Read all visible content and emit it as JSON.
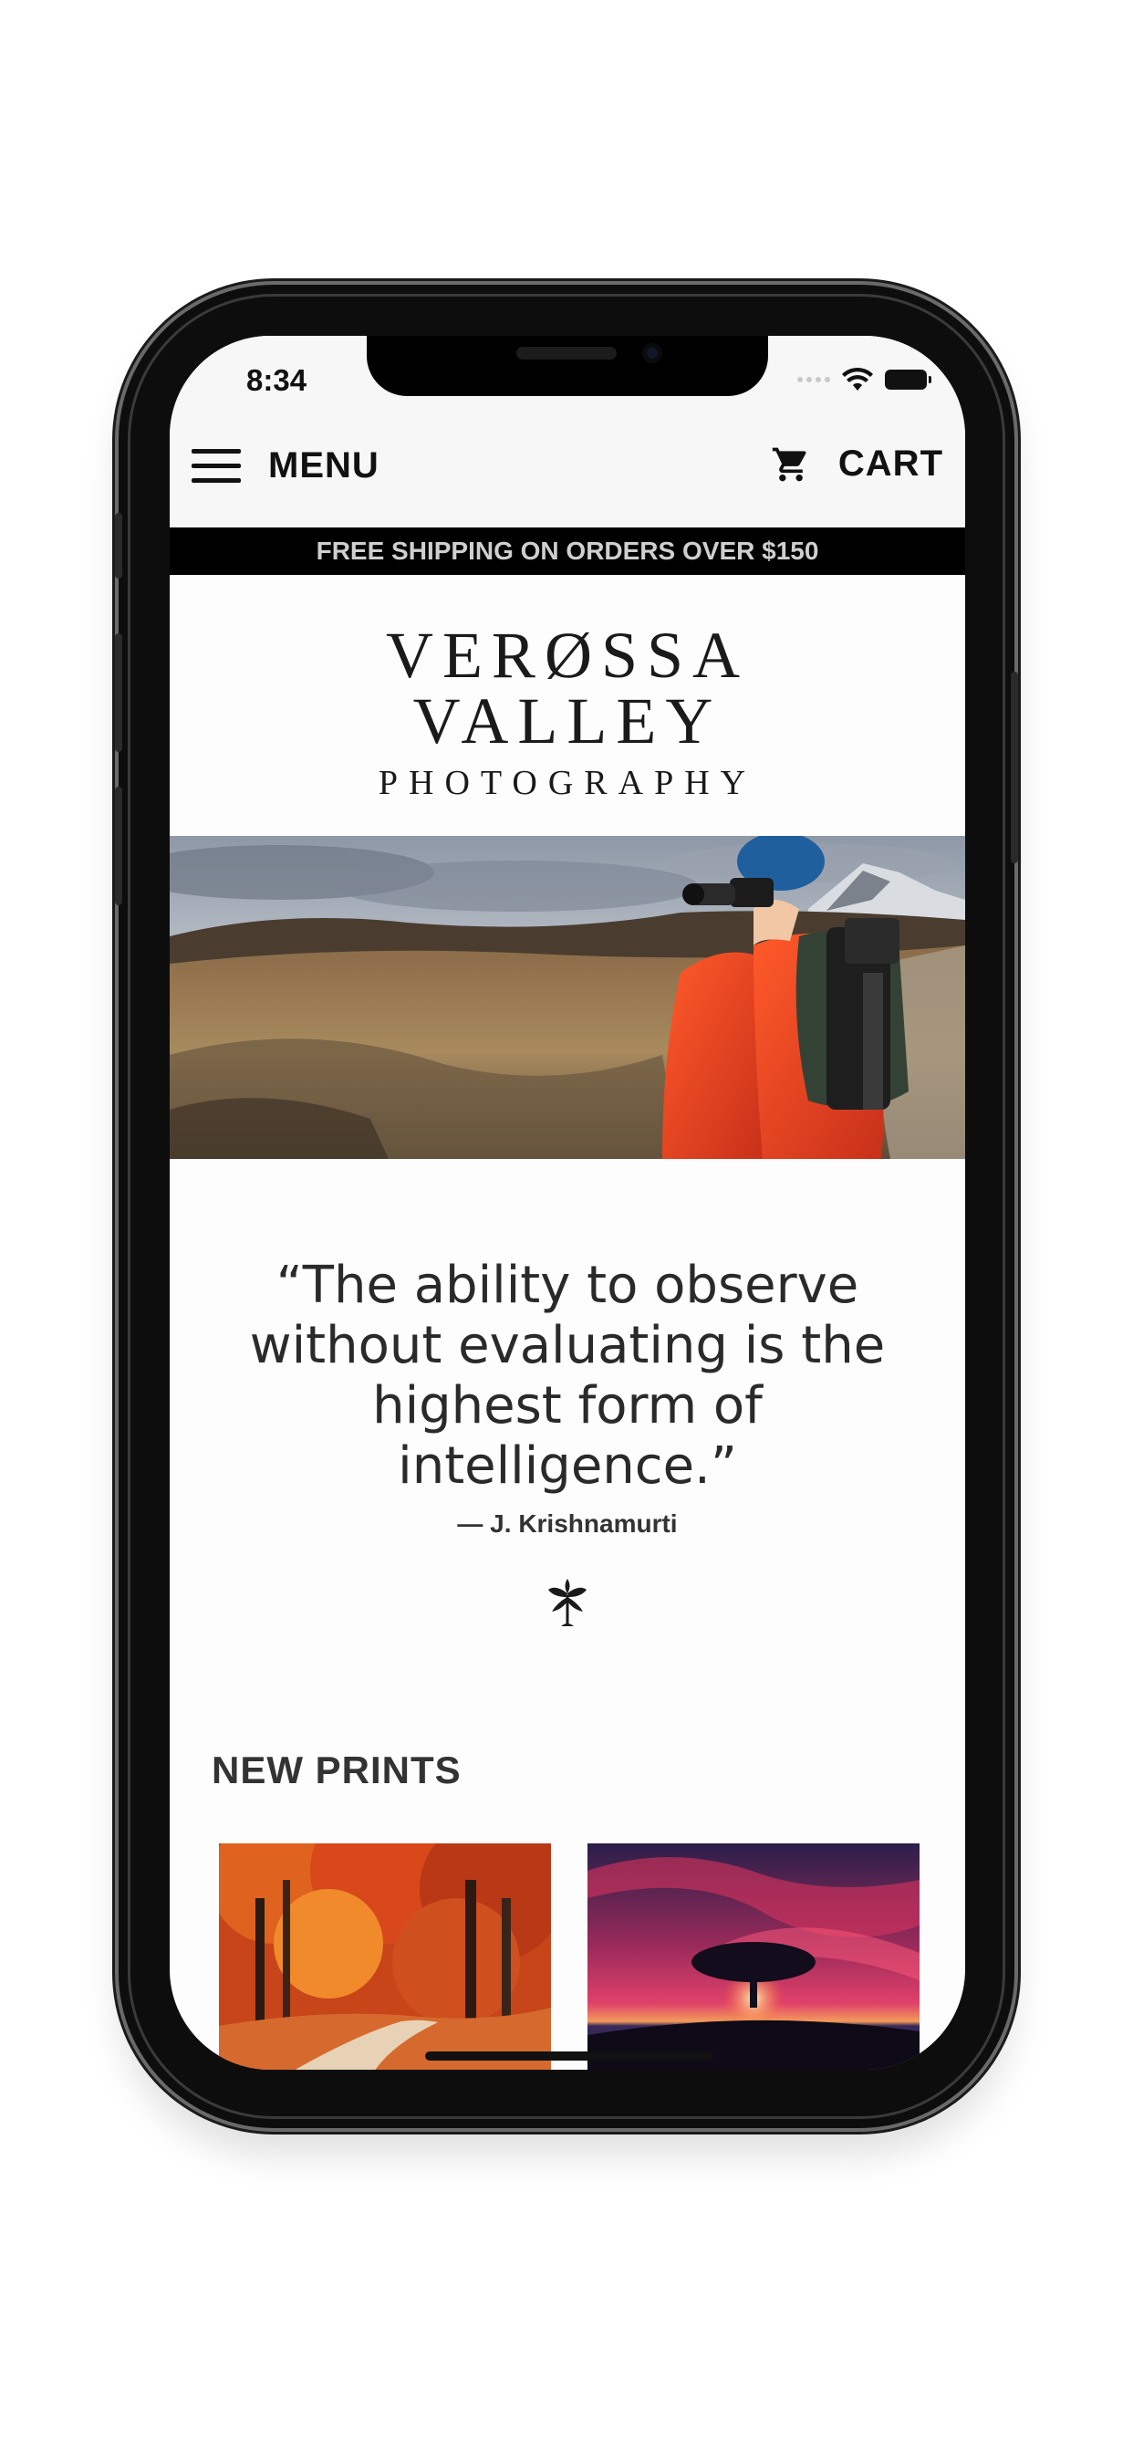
{
  "status_bar": {
    "time": "8:34"
  },
  "header": {
    "menu_label": "MENU",
    "cart_label": "CART"
  },
  "promo": {
    "text": "FREE SHIPPING ON ORDERS OVER $150"
  },
  "logo": {
    "line1": "VERØSSA",
    "line2": "VALLEY",
    "line3": "PHOTOGRAPHY"
  },
  "quote": {
    "text": "“The ability to observe without evaluating is the highest form of intelligence.”",
    "author": "— J. Krishnamurti"
  },
  "new_prints": {
    "title": "NEW PRINTS",
    "items": [
      {
        "icon": "autumn-forest-path-image"
      },
      {
        "icon": "tree-sunset-image"
      }
    ]
  },
  "colors": {
    "promo_bg": "#000000",
    "promo_text": "#cfcfcf",
    "header_bg": "#f7f7f7",
    "page_bg": "#fdfdfd"
  }
}
